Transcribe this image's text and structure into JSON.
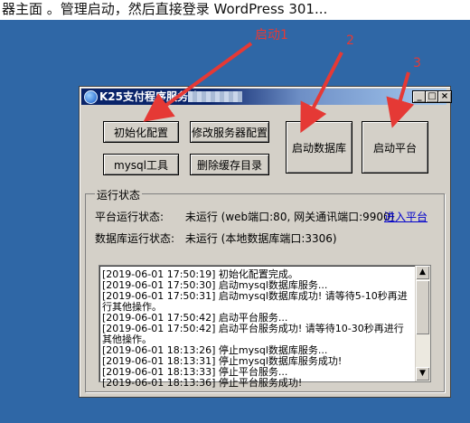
{
  "top_strip": {
    "text": "器主面 。管理启动，然后直接登录 WordPress 301..."
  },
  "annotations": {
    "a1": "启动1",
    "a2": "2",
    "a3": "3",
    "color": "#e53935"
  },
  "window": {
    "title": "K25支付程序服务端",
    "buttons": {
      "init_config": "初始化配置",
      "edit_server_config": "修改服务器配置",
      "mysql_tool": "mysql工具",
      "delete_cache": "删除缓存目录",
      "start_db": "启动数据库",
      "start_platform": "启动平台"
    },
    "status_group": {
      "legend": "运行状态",
      "platform_label": "平台运行状态:",
      "platform_value": "未运行 (web端口:80, 网关通讯端口:9900)",
      "enter_platform": "进入平台",
      "db_label": "数据库运行状态:",
      "db_value": "未运行 (本地数据库端口:3306)"
    },
    "log": [
      "[2019-06-01 17:50:19] 初始化配置完成。",
      "[2019-06-01 17:50:30] 启动mysql数据库服务...",
      "[2019-06-01 17:50:31] 启动mysql数据库成功! 请等待5-10秒再进行其他操作。",
      "[2019-06-01 17:50:42] 启动平台服务...",
      "[2019-06-01 17:50:42] 启动平台服务成功! 请等待10-30秒再进行其他操作。",
      "[2019-06-01 18:13:26] 停止mysql数据库服务...",
      "[2019-06-01 18:13:31] 停止mysql数据库服务成功!",
      "[2019-06-01 18:13:33] 停止平台服务...",
      "[2019-06-01 18:13:36] 停止平台服务成功!"
    ]
  }
}
